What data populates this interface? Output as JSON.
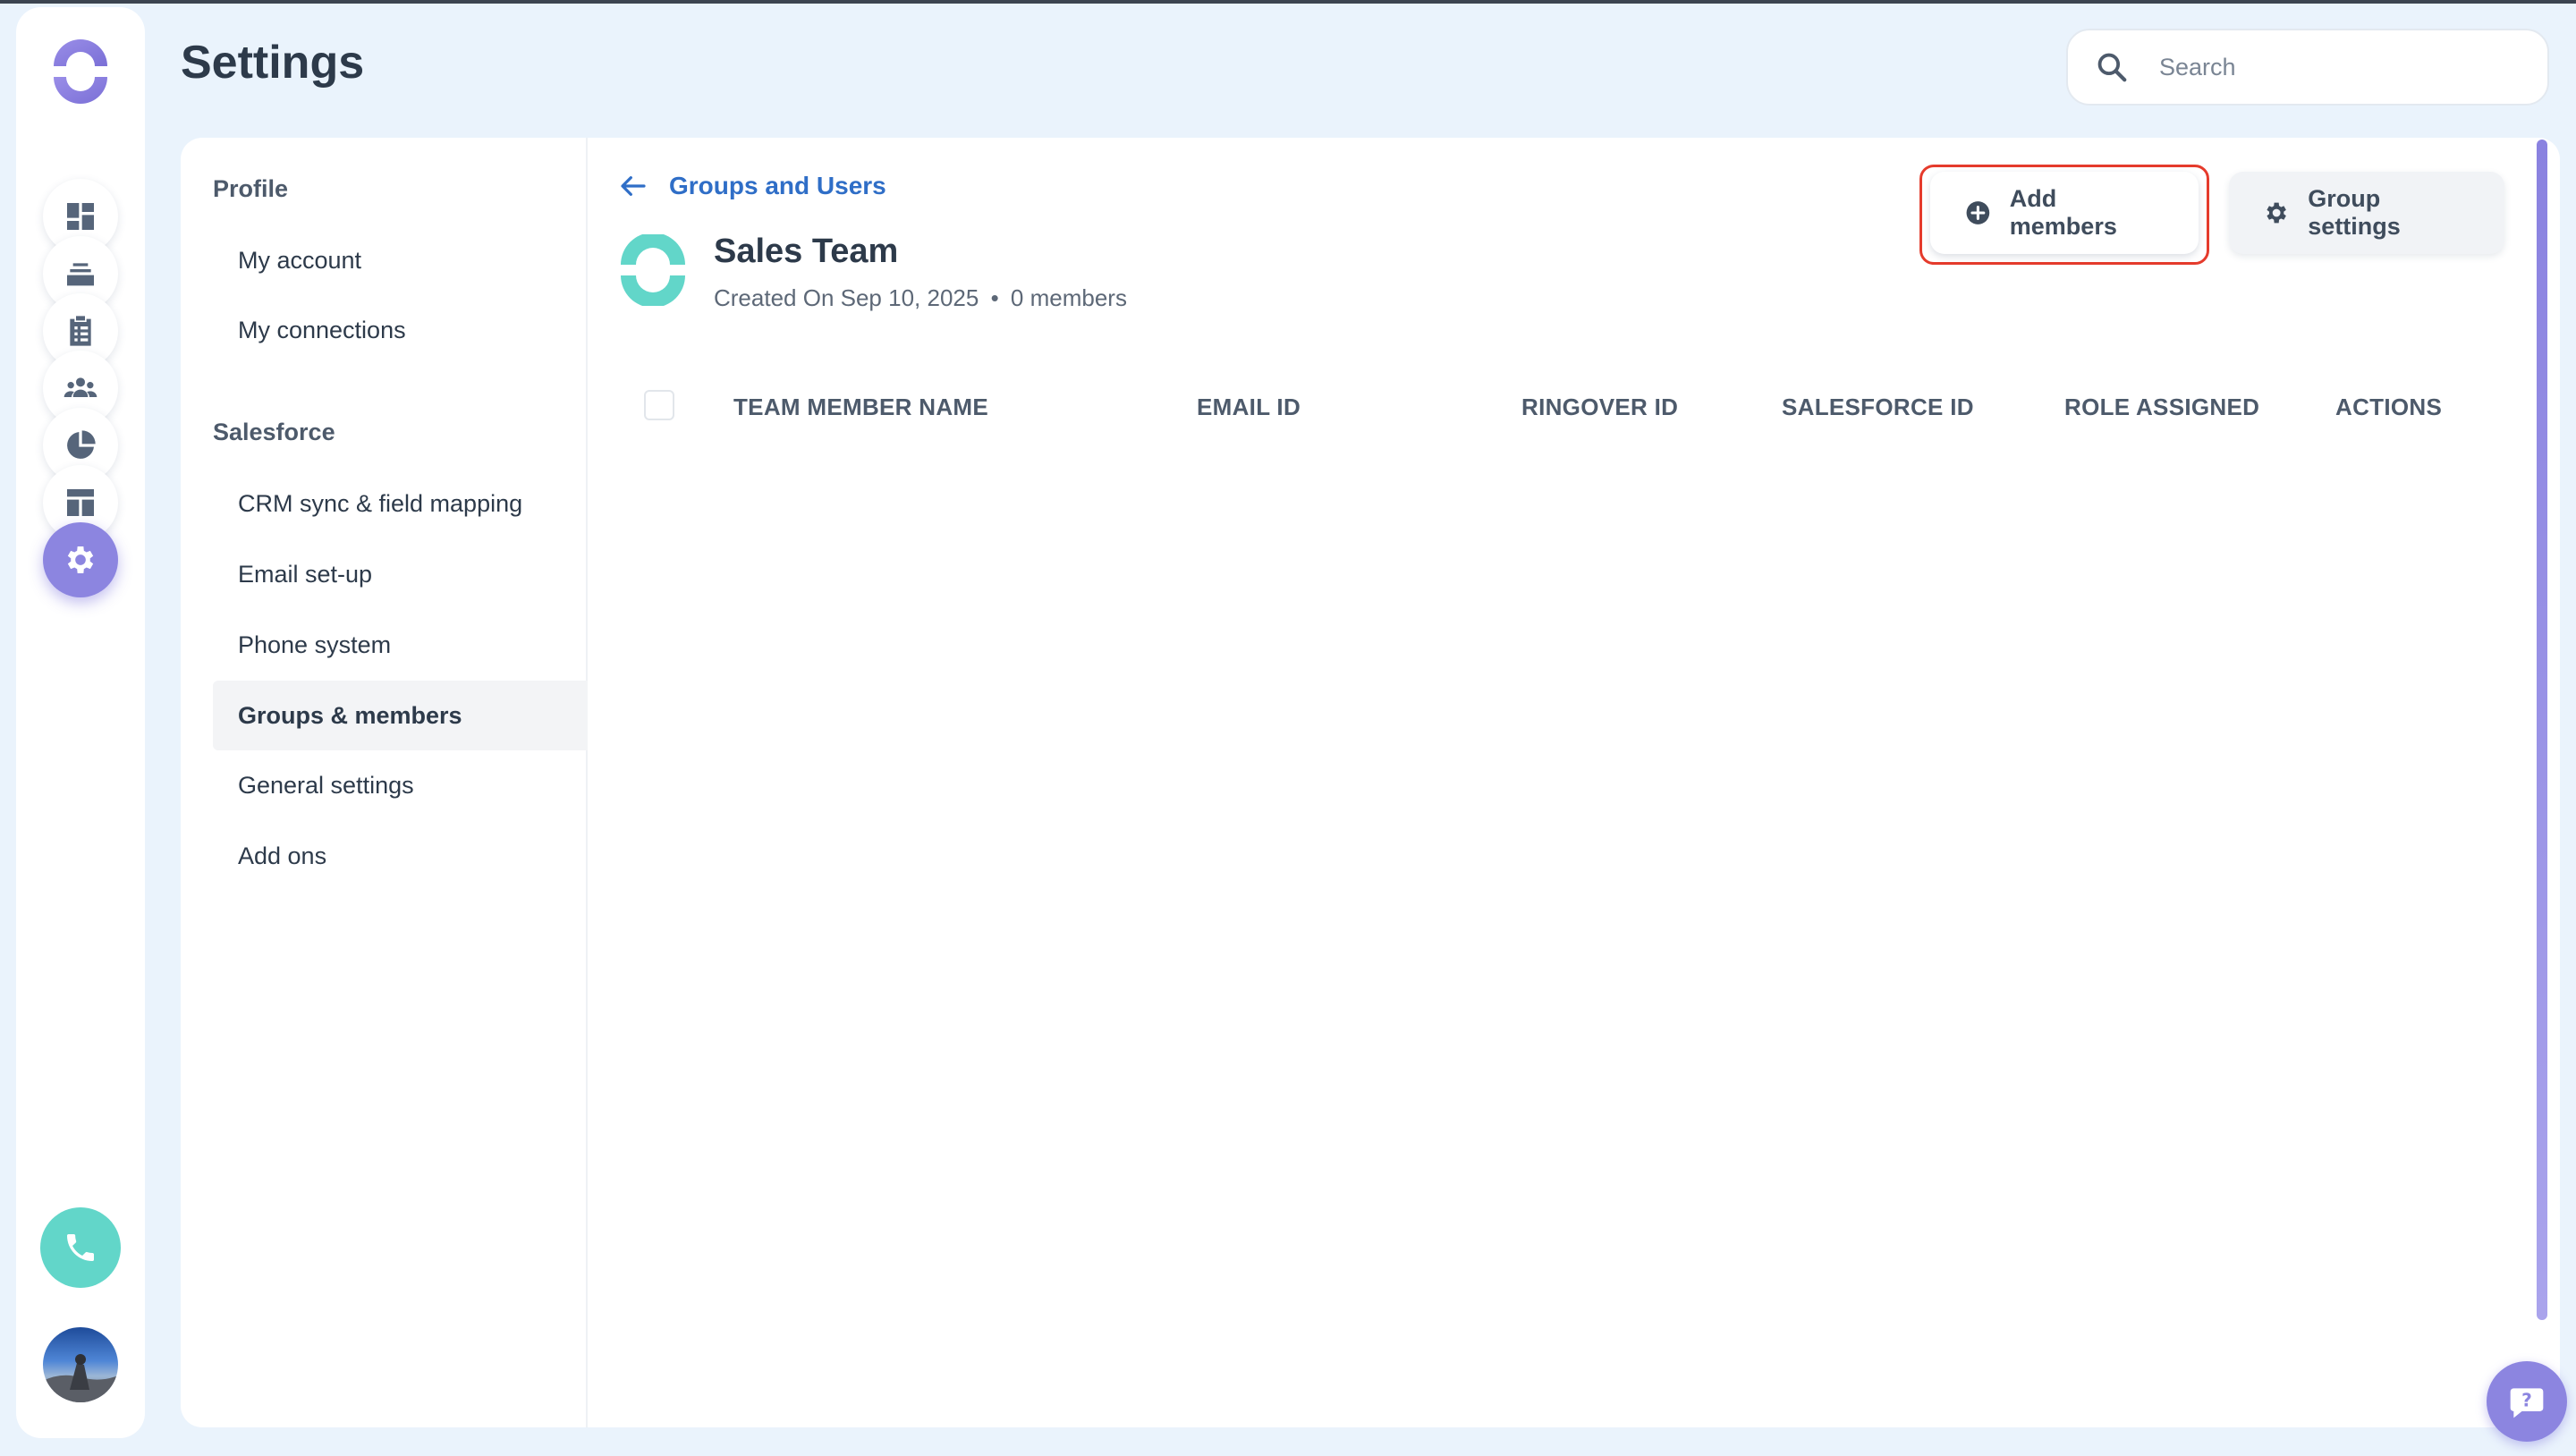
{
  "header": {
    "title": "Settings",
    "search": {
      "placeholder": "Search",
      "value": ""
    }
  },
  "rail": {
    "items": [
      {
        "name": "dashboard",
        "icon": "dashboard-icon"
      },
      {
        "name": "stack",
        "icon": "stack-icon"
      },
      {
        "name": "tasks",
        "icon": "clipboard-list-icon"
      },
      {
        "name": "people",
        "icon": "people-group-icon"
      },
      {
        "name": "reports",
        "icon": "pie-chart-icon"
      },
      {
        "name": "layout",
        "icon": "layout-icon"
      },
      {
        "name": "settings",
        "icon": "gear-icon",
        "active": true
      }
    ]
  },
  "settings_nav": {
    "sections": [
      {
        "heading": "Profile",
        "items": [
          "My account",
          "My connections"
        ]
      },
      {
        "heading": "Salesforce",
        "items": [
          "CRM sync & field mapping",
          "Email set-up",
          "Phone system",
          "Groups & members",
          "General settings",
          "Add ons"
        ]
      }
    ],
    "active_item": "Groups & members"
  },
  "content": {
    "back_link": "Groups and Users",
    "group": {
      "name": "Sales Team",
      "created": "Created On Sep 10, 2025",
      "separator": "•",
      "members": "0 members"
    },
    "buttons": {
      "add_members": "Add members",
      "group_settings": "Group settings"
    },
    "table": {
      "columns": [
        "TEAM MEMBER NAME",
        "EMAIL ID",
        "RINGOVER ID",
        "SALESFORCE ID",
        "ROLE ASSIGNED",
        "ACTIONS"
      ],
      "rows": []
    }
  },
  "colors": {
    "accent": "#8c85e0",
    "teal": "#62d6c9",
    "link": "#2f6ec7",
    "highlight": "#e53b2c"
  }
}
